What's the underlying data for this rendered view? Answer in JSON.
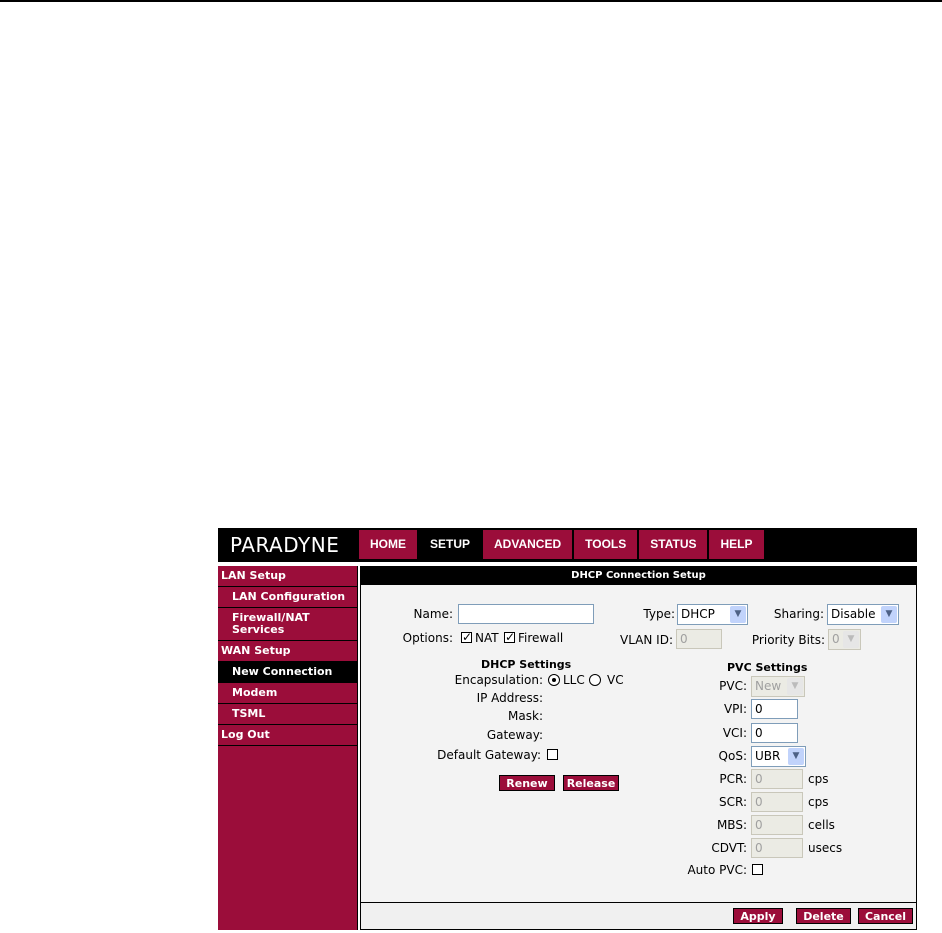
{
  "brand": {
    "logo_text": "PARADYNE"
  },
  "nav": {
    "tabs": [
      {
        "label": "HOME"
      },
      {
        "label": "SETUP"
      },
      {
        "label": "ADVANCED"
      },
      {
        "label": "TOOLS"
      },
      {
        "label": "STATUS"
      },
      {
        "label": "HELP"
      }
    ],
    "active": "SETUP"
  },
  "sidebar": {
    "items": [
      {
        "label": "LAN Setup"
      },
      {
        "label": "LAN Configuration"
      },
      {
        "label": "Firewall/NAT Services"
      },
      {
        "label": "WAN Setup"
      },
      {
        "label": "New Connection"
      },
      {
        "label": "Modem"
      },
      {
        "label": "TSML"
      },
      {
        "label": "Log Out"
      }
    ],
    "active": "New Connection"
  },
  "main": {
    "title": "DHCP Connection Setup",
    "name_label": "Name:",
    "name_value": "",
    "type_label": "Type:",
    "type_value": "DHCP",
    "sharing_label": "Sharing:",
    "sharing_value": "Disable",
    "options_label": "Options:",
    "nat_label": "NAT",
    "nat_checked": true,
    "firewall_label": "Firewall",
    "firewall_checked": true,
    "vlan_label": "VLAN ID:",
    "vlan_value": "0",
    "priority_label": "Priority Bits:",
    "priority_value": "0"
  },
  "dhcp": {
    "title": "DHCP Settings",
    "encap_label": "Encapsulation:",
    "llc_label": "LLC",
    "vc_label": "VC",
    "encap_selected": "LLC",
    "ip_label": "IP Address:",
    "mask_label": "Mask:",
    "gateway_label": "Gateway:",
    "default_gw_label": "Default Gateway:",
    "default_gw_checked": false,
    "renew_label": "Renew",
    "release_label": "Release"
  },
  "pvc": {
    "title": "PVC Settings",
    "pvc_label": "PVC:",
    "pvc_value": "New",
    "vpi_label": "VPI:",
    "vpi_value": "0",
    "vci_label": "VCI:",
    "vci_value": "0",
    "qos_label": "QoS:",
    "qos_value": "UBR",
    "pcr_label": "PCR:",
    "pcr_value": "0",
    "pcr_unit": "cps",
    "scr_label": "SCR:",
    "scr_value": "0",
    "scr_unit": "cps",
    "mbs_label": "MBS:",
    "mbs_value": "0",
    "mbs_unit": "cells",
    "cdvt_label": "CDVT:",
    "cdvt_value": "0",
    "cdvt_unit": "usecs",
    "auto_pvc_label": "Auto PVC:",
    "auto_pvc_checked": false
  },
  "actions": {
    "apply_label": "Apply",
    "delete_label": "Delete",
    "cancel_label": "Cancel"
  },
  "colors": {
    "brand": "#9b0d3a",
    "header": "#000000"
  }
}
